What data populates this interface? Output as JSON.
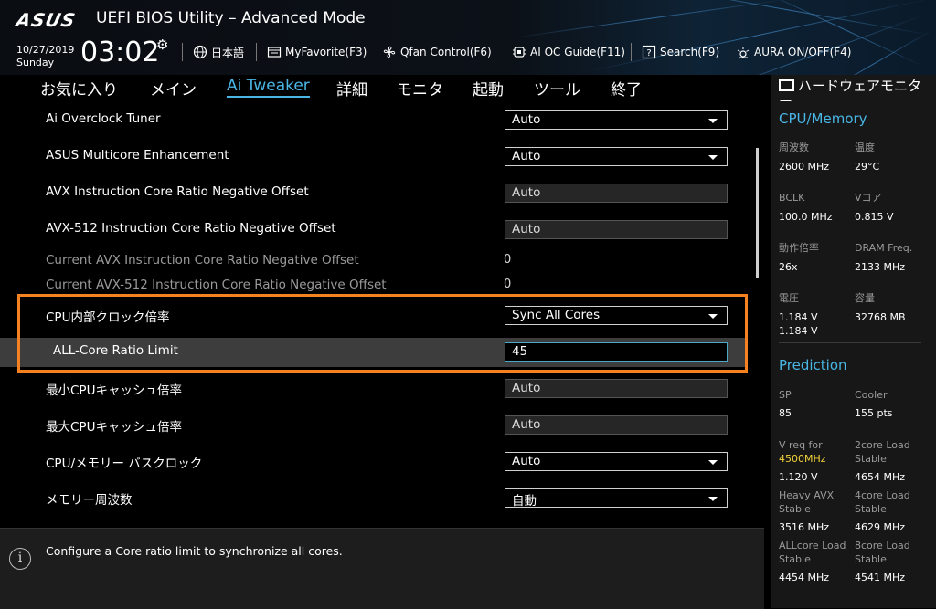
{
  "header": {
    "logo": "ASUS",
    "title": "UEFI BIOS Utility – Advanced Mode",
    "date": "10/27/2019",
    "day": "Sunday",
    "time": "03:02",
    "language": "日本語",
    "my_favorite": "MyFavorite(F3)",
    "qfan": "Qfan Control(F6)",
    "ai_oc_guide": "AI OC Guide(F11)",
    "search": "Search(F9)",
    "aura": "AURA ON/OFF(F4)"
  },
  "tabs": [
    "お気に入り",
    "メイン",
    "Ai Tweaker",
    "詳細",
    "モニタ",
    "起動",
    "ツール",
    "終了"
  ],
  "active_tab": "Ai Tweaker",
  "settings": [
    {
      "label": "Ai Overclock Tuner",
      "value": "Auto",
      "control": "dropdown"
    },
    {
      "label": "ASUS Multicore Enhancement",
      "value": "Auto",
      "control": "dropdown"
    },
    {
      "label": "AVX Instruction Core Ratio Negative Offset",
      "value": "Auto",
      "control": "field"
    },
    {
      "label": "AVX-512 Instruction Core Ratio Negative Offset",
      "value": "Auto",
      "control": "field"
    },
    {
      "label": "Current AVX Instruction Core Ratio Negative Offset",
      "value": "0",
      "control": "static"
    },
    {
      "label": "Current AVX-512 Instruction Core Ratio Negative Offset",
      "value": "0",
      "control": "static"
    },
    {
      "label": "CPU内部クロック倍率",
      "value": "Sync All Cores",
      "control": "dropdown"
    },
    {
      "label": "ALL-Core Ratio Limit",
      "value": "45",
      "control": "field-active"
    },
    {
      "label": "最小CPUキャッシュ倍率",
      "value": "Auto",
      "control": "field"
    },
    {
      "label": "最大CPUキャッシュ倍率",
      "value": "Auto",
      "control": "field"
    },
    {
      "label": "CPU/メモリー バスクロック",
      "value": "Auto",
      "control": "dropdown"
    },
    {
      "label": "メモリー周波数",
      "value": "自動",
      "control": "dropdown"
    }
  ],
  "help_text": "Configure a Core ratio limit to synchronize all cores.",
  "hw_monitor": {
    "title": "ハードウェアモニター",
    "cpu_memory": {
      "heading": "CPU/Memory",
      "frequency_label": "周波数",
      "frequency": "2600 MHz",
      "temperature_label": "温度",
      "temperature": "29°C",
      "bclk_label": "BCLK",
      "bclk": "100.0 MHz",
      "vcore_label": "Vコア",
      "vcore": "0.815 V",
      "ratio_label": "動作倍率",
      "ratio": "26x",
      "dram_freq_label": "DRAM Freq.",
      "dram_freq": "2133 MHz",
      "voltage_label": "電圧",
      "voltage_1": "1.184 V",
      "voltage_2": "1.184 V",
      "capacity_label": "容量",
      "capacity": "32768 MB"
    },
    "prediction": {
      "heading": "Prediction",
      "sp_label": "SP",
      "sp": "85",
      "cooler_label": "Cooler",
      "cooler": "155 pts",
      "vreq_label": "V req for",
      "vreq_freq": "4500MHz",
      "vreq": "1.120 V",
      "core2_label_1": "2core Load",
      "core2_label_2": "Stable",
      "core2": "4654 MHz",
      "heavy_avx_label_1": "Heavy AVX",
      "heavy_avx_label_2": "Stable",
      "heavy_avx": "3516 MHz",
      "core4_label_1": "4core Load",
      "core4_label_2": "Stable",
      "core4": "4629 MHz",
      "allcore_label_1": "ALLcore Load",
      "allcore_label_2": "Stable",
      "allcore": "4454 MHz",
      "core8_label_1": "8core Load",
      "core8_label_2": "Stable",
      "core8": "4541 MHz"
    }
  }
}
